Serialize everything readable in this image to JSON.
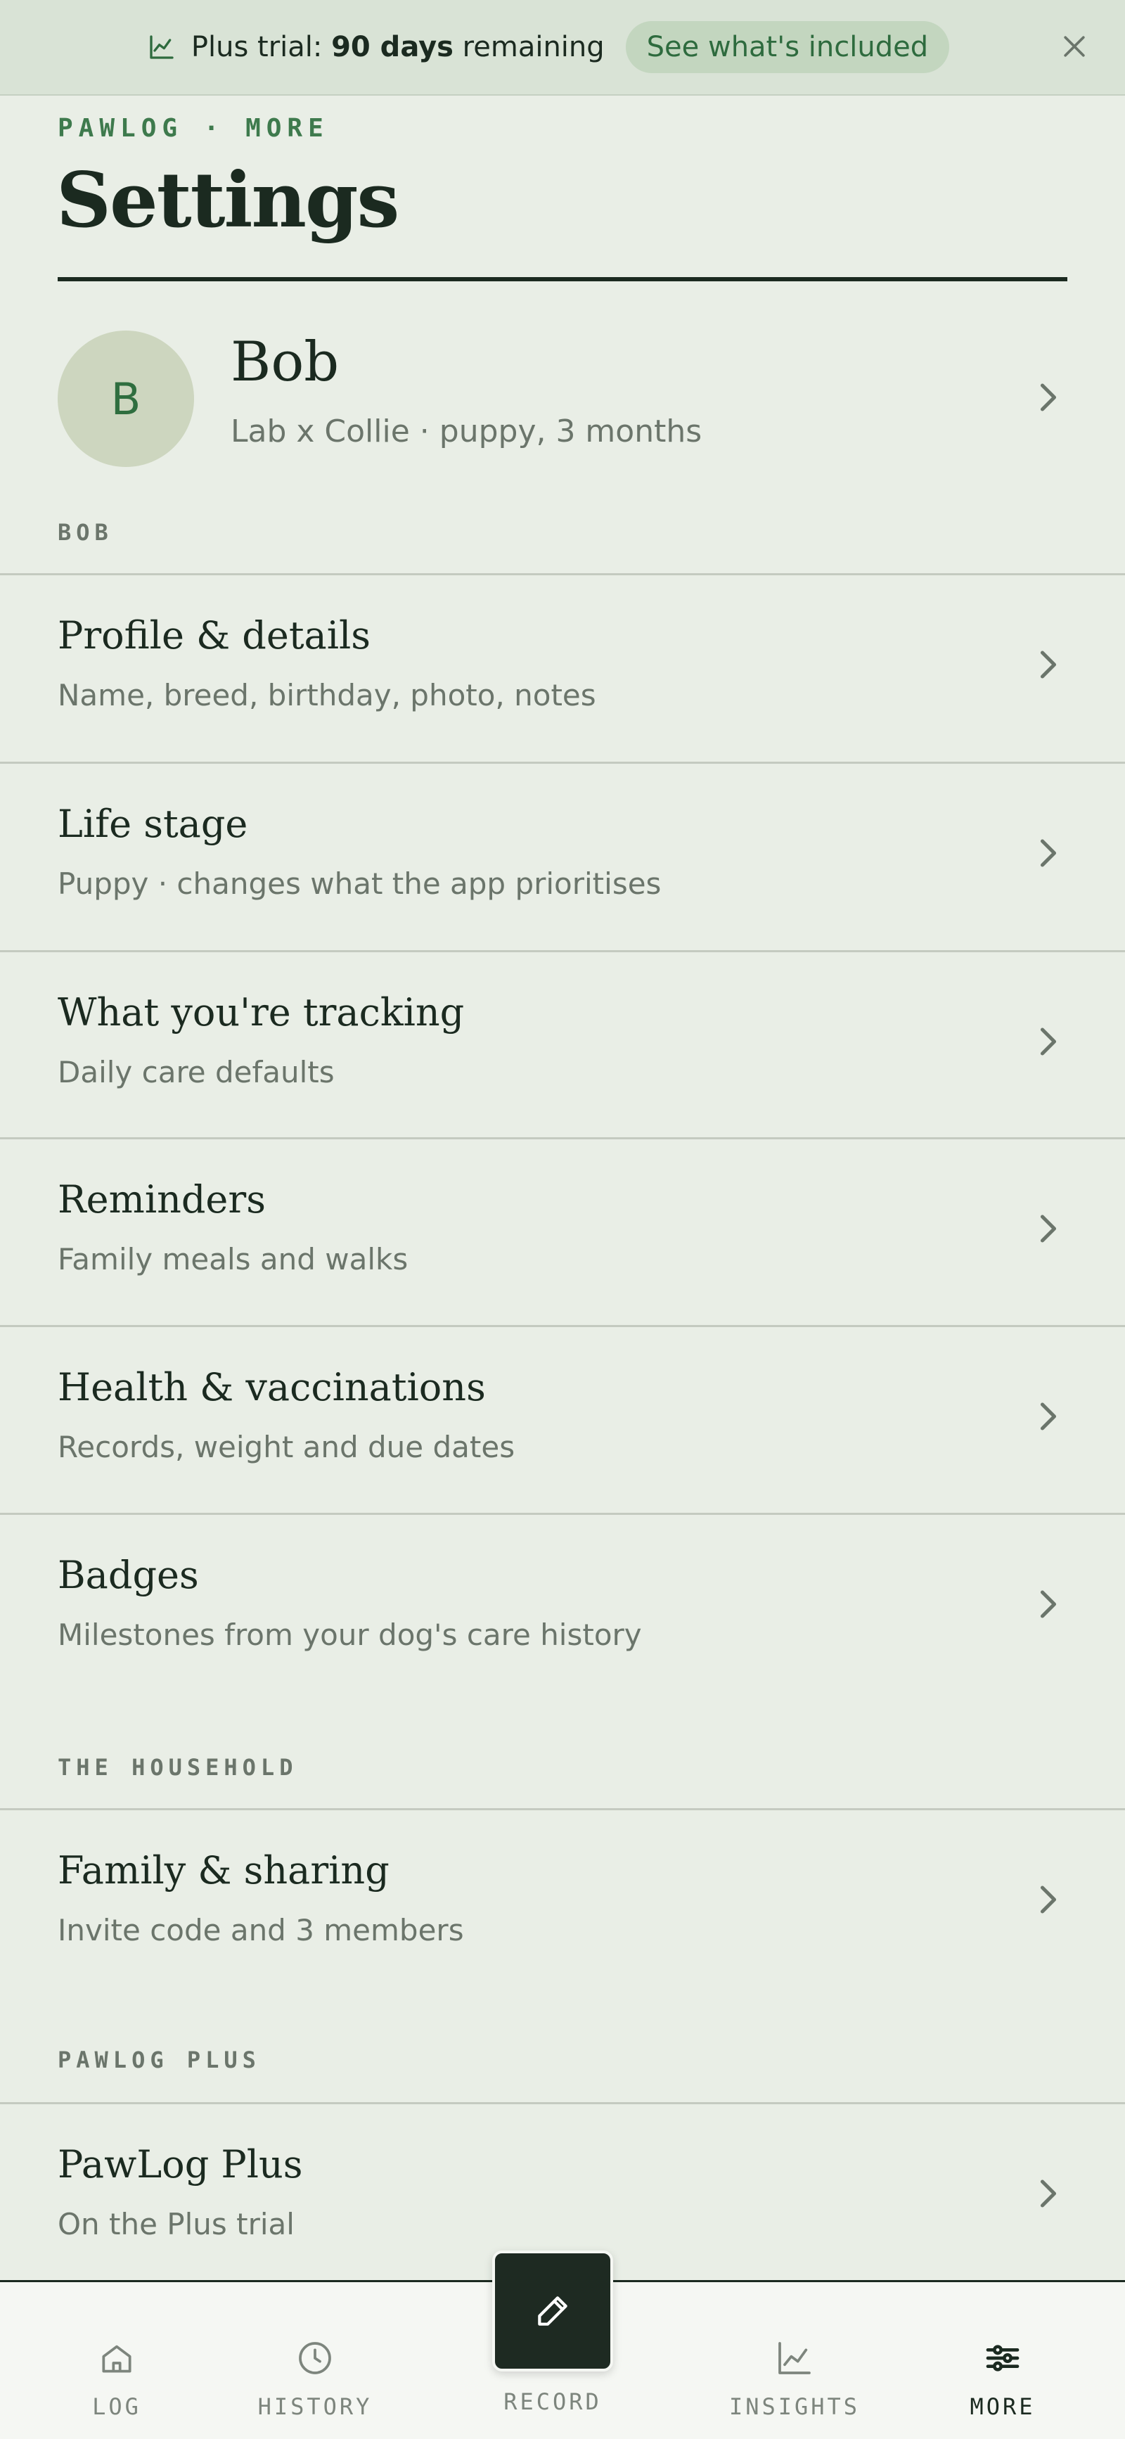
{
  "banner": {
    "prefix": "Plus trial: ",
    "days": "90 days",
    "suffix": " remaining",
    "cta": "See what's included",
    "icon": "chart-line-icon",
    "close_icon": "close-icon"
  },
  "header": {
    "eyebrow": "PAWLOG · MORE",
    "title": "Settings"
  },
  "profile": {
    "initial": "B",
    "name": "Bob",
    "subtitle": "Lab x Collie · puppy, 3 months"
  },
  "sections": {
    "dog_label": "BOB",
    "household_label": "THE HOUSEHOLD",
    "plus_label": "PAWLOG PLUS"
  },
  "rows": [
    {
      "title": "Profile & details",
      "subtitle": "Name, breed, birthday, photo, notes"
    },
    {
      "title": "Life stage",
      "subtitle": "Puppy · changes what the app prioritises"
    },
    {
      "title": "What you're tracking",
      "subtitle": "Daily care defaults"
    },
    {
      "title": "Reminders",
      "subtitle": "Family meals and walks"
    },
    {
      "title": "Health & vaccinations",
      "subtitle": "Records, weight and due dates"
    },
    {
      "title": "Badges",
      "subtitle": "Milestones from your dog's care history"
    },
    {
      "title": "Family & sharing",
      "subtitle": "Invite code and 3 members"
    },
    {
      "title": "PawLog Plus",
      "subtitle": "On the Plus trial"
    }
  ],
  "nav": {
    "log": "LOG",
    "history": "HISTORY",
    "record": "RECORD",
    "insights": "INSIGHTS",
    "more": "MORE",
    "active": "MORE"
  },
  "colors": {
    "background": "#e9eee6",
    "accent": "#3e7a4d",
    "ink": "#1b2a20",
    "muted": "#6b756b"
  }
}
